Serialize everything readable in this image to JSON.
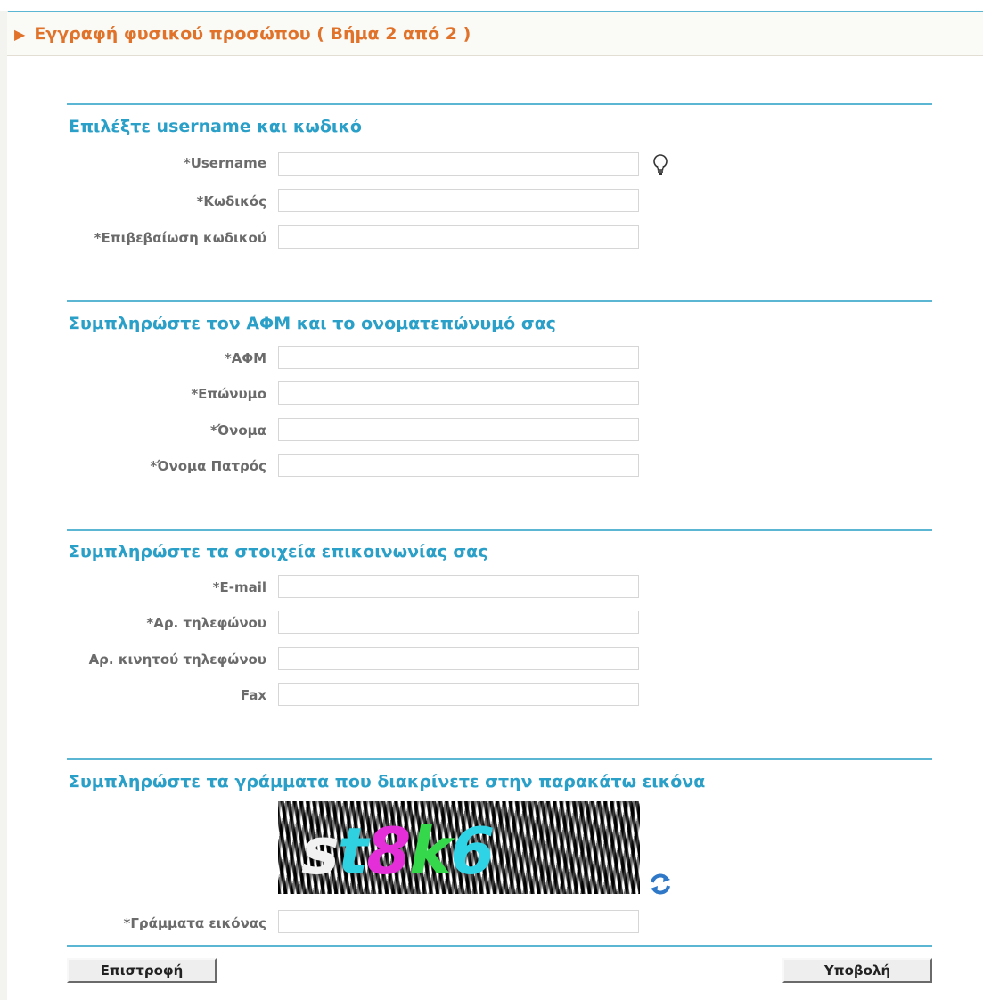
{
  "header": {
    "arrow": "▶",
    "title": "Εγγραφή φυσικού προσώπου ( Βήμα 2 από 2 )"
  },
  "sections": [
    {
      "title": "Επιλέξτε username και κωδικό",
      "fields": [
        {
          "label": "*Username",
          "value": ""
        },
        {
          "label": "*Κωδικός",
          "value": ""
        },
        {
          "label": "*Επιβεβαίωση κωδικού",
          "value": ""
        }
      ]
    },
    {
      "title": "Συμπληρώστε τον ΑΦΜ και το ονοματεπώνυμό σας",
      "fields": [
        {
          "label": "*ΑΦΜ",
          "value": ""
        },
        {
          "label": "*Επώνυμο",
          "value": ""
        },
        {
          "label": "*Όνομα",
          "value": ""
        },
        {
          "label": "*Όνομα Πατρός",
          "value": ""
        }
      ]
    },
    {
      "title": "Συμπληρώστε τα στοιχεία επικοινωνίας σας",
      "fields": [
        {
          "label": "*E-mail",
          "value": ""
        },
        {
          "label": "*Αρ. τηλεφώνου",
          "value": ""
        },
        {
          "label": "Αρ. κινητού τηλεφώνου",
          "value": ""
        },
        {
          "label": "Fax",
          "value": ""
        }
      ]
    },
    {
      "title": "Συμπληρώστε τα γράμματα που διακρίνετε στην παρακάτω εικόνα",
      "captcha": {
        "chars": [
          {
            "c": "s",
            "color": "#f2f2f2"
          },
          {
            "c": "t",
            "color": "#2fd0e0"
          },
          {
            "c": "8",
            "color": "#e42fd8"
          },
          {
            "c": "k",
            "color": "#35d84a"
          },
          {
            "c": "6",
            "color": "#2fd3e6"
          }
        ]
      },
      "fields": [
        {
          "label": "*Γράμματα εικόνας",
          "value": ""
        }
      ]
    }
  ],
  "buttons": {
    "back": "Επιστροφή",
    "submit": "Υποβολή"
  },
  "icons": {
    "hint": "lightbulb-icon",
    "refresh": "refresh-icon"
  },
  "colors": {
    "accent": "#2a9fc7",
    "header": "#e0722a",
    "rule": "#5bb6d3"
  }
}
